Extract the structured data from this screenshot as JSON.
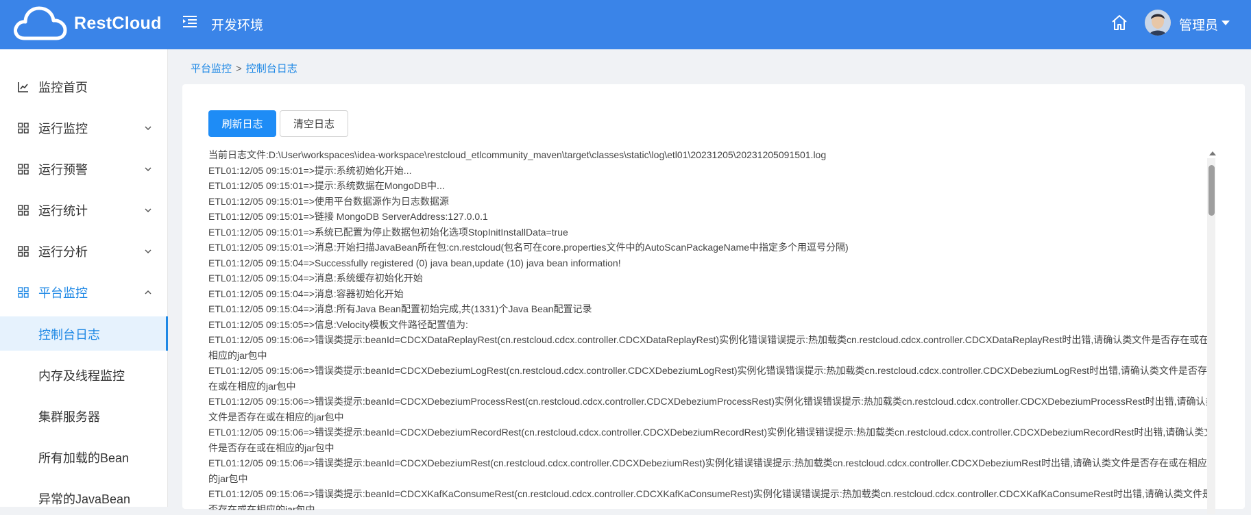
{
  "header": {
    "app_name": "RestCloud",
    "env_title": "开发环境",
    "user_name": "管理员"
  },
  "breadcrumb": {
    "parent": "平台监控",
    "separator": ">",
    "current": "控制台日志"
  },
  "sidebar": {
    "items": [
      {
        "label": "监控首页",
        "icon": "line-chart-icon"
      },
      {
        "label": "运行监控",
        "icon": "grid-icon",
        "expanded": false
      },
      {
        "label": "运行预警",
        "icon": "grid-icon",
        "expanded": false
      },
      {
        "label": "运行统计",
        "icon": "grid-icon",
        "expanded": false
      },
      {
        "label": "运行分析",
        "icon": "grid-icon",
        "expanded": false
      },
      {
        "label": "平台监控",
        "icon": "grid-icon",
        "expanded": true
      }
    ],
    "sub_items": [
      {
        "label": "控制台日志",
        "selected": true
      },
      {
        "label": "内存及线程监控"
      },
      {
        "label": "集群服务器"
      },
      {
        "label": "所有加载的Bean"
      },
      {
        "label": "异常的JavaBean"
      }
    ]
  },
  "toolbar": {
    "refresh_label": "刷新日志",
    "clear_label": "清空日志"
  },
  "log": {
    "lines": [
      "当前日志文件:D:\\User\\workspaces\\idea-workspace\\restcloud_etlcommunity_maven\\target\\classes\\static\\log\\etl01\\20231205\\20231205091501.log",
      "ETL01:12/05 09:15:01=>提示:系统初始化开始...",
      "ETL01:12/05 09:15:01=>提示:系统数据在MongoDB中...",
      "ETL01:12/05 09:15:01=>使用平台数据源作为日志数据源",
      "ETL01:12/05 09:15:01=>链接 MongoDB ServerAddress:127.0.0.1",
      "ETL01:12/05 09:15:01=>系统已配置为停止数据包初始化选项StopInitInstallData=true",
      "ETL01:12/05 09:15:01=>消息:开始扫描JavaBean所在包:cn.restcloud(包名可在core.properties文件中的AutoScanPackageName中指定多个用逗号分隔)",
      "ETL01:12/05 09:15:04=>Successfully registered (0) java bean,update (10) java bean information!",
      "ETL01:12/05 09:15:04=>消息:系统缓存初始化开始",
      "ETL01:12/05 09:15:04=>消息:容器初始化开始",
      "ETL01:12/05 09:15:04=>消息:所有Java Bean配置初始完成,共(1331)个Java Bean配置记录",
      "ETL01:12/05 09:15:05=>信息:Velocity模板文件路径配置值为:",
      "ETL01:12/05 09:15:06=>错误类提示:beanId=CDCXDataReplayRest(cn.restcloud.cdcx.controller.CDCXDataReplayRest)实例化错误错误提示:热加载类cn.restcloud.cdcx.controller.CDCXDataReplayRest时出错,请确认类文件是否存在或在相应的jar包中",
      "ETL01:12/05 09:15:06=>错误类提示:beanId=CDCXDebeziumLogRest(cn.restcloud.cdcx.controller.CDCXDebeziumLogRest)实例化错误错误提示:热加载类cn.restcloud.cdcx.controller.CDCXDebeziumLogRest时出错,请确认类文件是否存在或在相应的jar包中",
      "ETL01:12/05 09:15:06=>错误类提示:beanId=CDCXDebeziumProcessRest(cn.restcloud.cdcx.controller.CDCXDebeziumProcessRest)实例化错误错误提示:热加载类cn.restcloud.cdcx.controller.CDCXDebeziumProcessRest时出错,请确认类文件是否存在或在相应的jar包中",
      "ETL01:12/05 09:15:06=>错误类提示:beanId=CDCXDebeziumRecordRest(cn.restcloud.cdcx.controller.CDCXDebeziumRecordRest)实例化错误错误提示:热加载类cn.restcloud.cdcx.controller.CDCXDebeziumRecordRest时出错,请确认类文件是否存在或在相应的jar包中",
      "ETL01:12/05 09:15:06=>错误类提示:beanId=CDCXDebeziumRest(cn.restcloud.cdcx.controller.CDCXDebeziumRest)实例化错误错误提示:热加载类cn.restcloud.cdcx.controller.CDCXDebeziumRest时出错,请确认类文件是否存在或在相应的jar包中",
      "ETL01:12/05 09:15:06=>错误类提示:beanId=CDCXKafKaConsumeRest(cn.restcloud.cdcx.controller.CDCXKafKaConsumeRest)实例化错误错误提示:热加载类cn.restcloud.cdcx.controller.CDCXKafKaConsumeRest时出错,请确认类文件是否存在或在相应的jar包中"
    ]
  }
}
